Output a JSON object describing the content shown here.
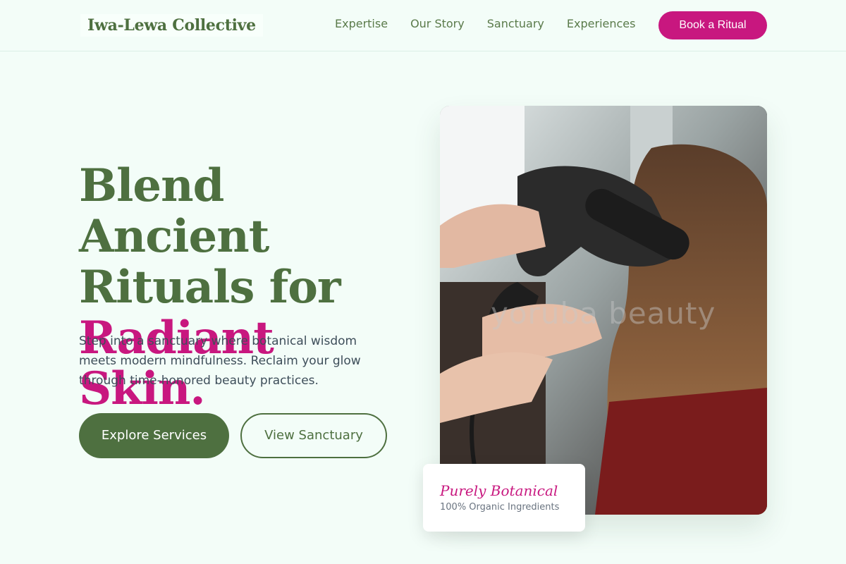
{
  "header": {
    "logo": "Iwa-Lewa Collective",
    "nav": [
      "Expertise",
      "Our Story",
      "Sanctuary",
      "Experiences"
    ],
    "cta": "Book a Ritual"
  },
  "hero": {
    "title_line1": "Blend Ancient",
    "title_line2": "Rituals for",
    "title_accent": "Radiant Skin.",
    "subtitle": "Step into a sanctuary where botanical wisdom meets modern mindfulness. Reclaim your glow through time-honored beauty practices.",
    "primary_button": "Explore Services",
    "secondary_button": "View Sanctuary"
  },
  "image": {
    "watermark": "yoruba beauty"
  },
  "badge": {
    "title": "Purely Botanical",
    "subtitle": "100% Organic Ingredients"
  },
  "colors": {
    "brand_green": "#4e7040",
    "accent_magenta": "#c8177f",
    "background": "#f3fdf8"
  }
}
